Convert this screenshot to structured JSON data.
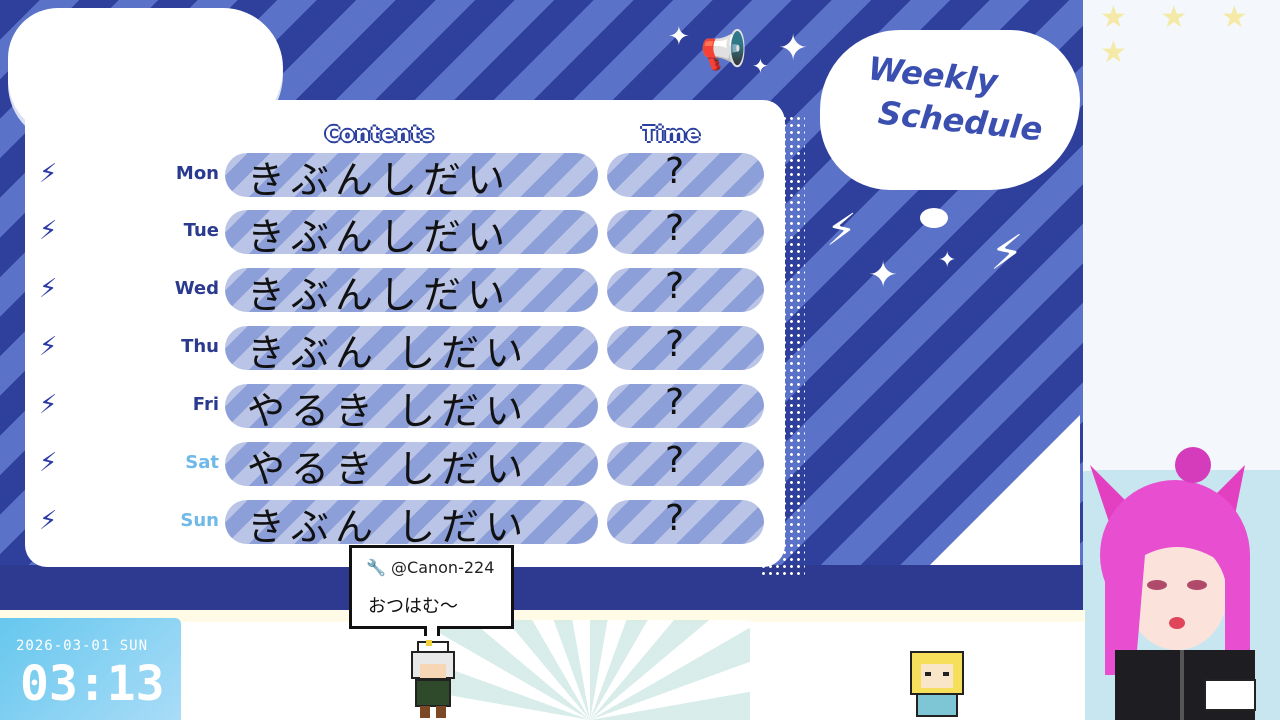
{
  "schedule": {
    "title_line1": "Weekly",
    "title_line2": "Schedule",
    "contents_header": "Contents",
    "time_header": "Time",
    "rows": [
      {
        "day": "Mon",
        "content": "きぶんしだい",
        "time": "?"
      },
      {
        "day": "Tue",
        "content": "きぶんしだい",
        "time": "?"
      },
      {
        "day": "Wed",
        "content": "きぶんしだい",
        "time": "?"
      },
      {
        "day": "Thu",
        "content": "きぶん しだい",
        "time": "?"
      },
      {
        "day": "Fri",
        "content": "やるき しだい",
        "time": "?"
      },
      {
        "day": "Sat",
        "content": "やるき しだい",
        "time": "?"
      },
      {
        "day": "Sun",
        "content": "きぶん しだい",
        "time": "?"
      }
    ]
  },
  "chat": {
    "user": "@Canon-224",
    "message": "おつはむ〜"
  },
  "clock": {
    "date": "2026-03-01 SUN",
    "time": "03:13"
  },
  "colors": {
    "accent": "#2f3f9c",
    "stripe": "#5b72c9",
    "pill": "#8d9fd8",
    "clock": "#66c7ee"
  },
  "icons": {
    "bolt": "lightning-icon",
    "wrench": "wrench-icon",
    "megaphone": "megaphone-icon"
  }
}
